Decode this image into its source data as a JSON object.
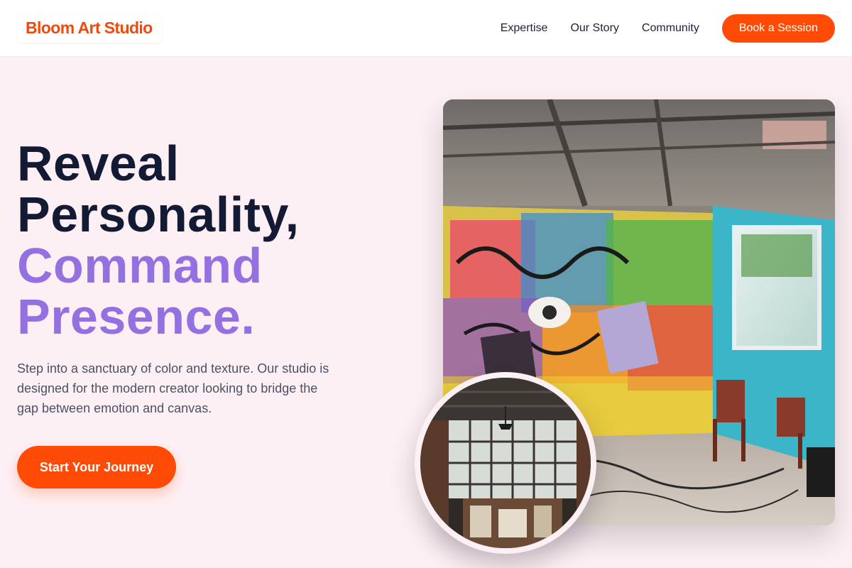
{
  "header": {
    "brand": "Bloom Art Studio",
    "nav": [
      "Expertise",
      "Our Story",
      "Community"
    ],
    "cta": "Book a Session"
  },
  "hero": {
    "headline_line1": "Reveal",
    "headline_line2": "Personality,",
    "headline_line3": "Command",
    "headline_line4": "Presence.",
    "description": "Step into a sanctuary of color and texture. Our studio is designed for the modern creator looking to bridge the gap between emotion and canvas.",
    "cta": "Start Your Journey"
  },
  "colors": {
    "accent": "#ff4b05",
    "brand": "#ee4a0c",
    "heading_dark": "#131a34",
    "heading_purple": "#9570e0",
    "background": "#fdf0f4"
  }
}
